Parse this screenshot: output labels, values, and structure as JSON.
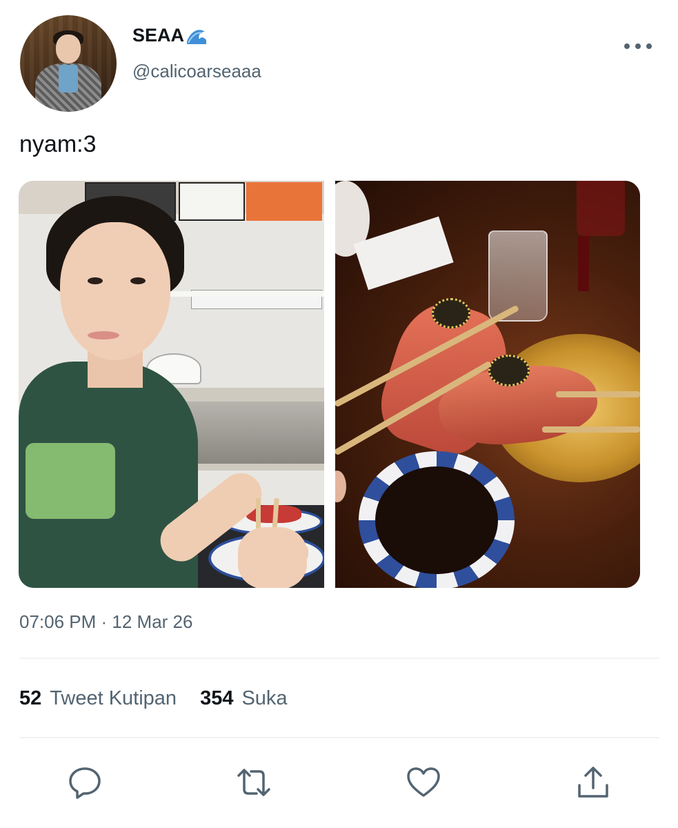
{
  "user": {
    "display_name": "SEAA",
    "emoji": "wave-icon",
    "handle": "@calicoarseaaa"
  },
  "tweet": {
    "text": "nyam:3",
    "timestamp": "07:06 PM · 12 Mar 26"
  },
  "stats": {
    "quotes_count": "52",
    "quotes_label": "Tweet Kutipan",
    "likes_count": "354",
    "likes_label": "Suka"
  },
  "icons": [
    "more-icon",
    "reply-icon",
    "retweet-icon",
    "like-icon",
    "share-icon"
  ],
  "colors": {
    "text_primary": "#0f1419",
    "text_secondary": "#536471",
    "divider": "#eff3f4"
  }
}
